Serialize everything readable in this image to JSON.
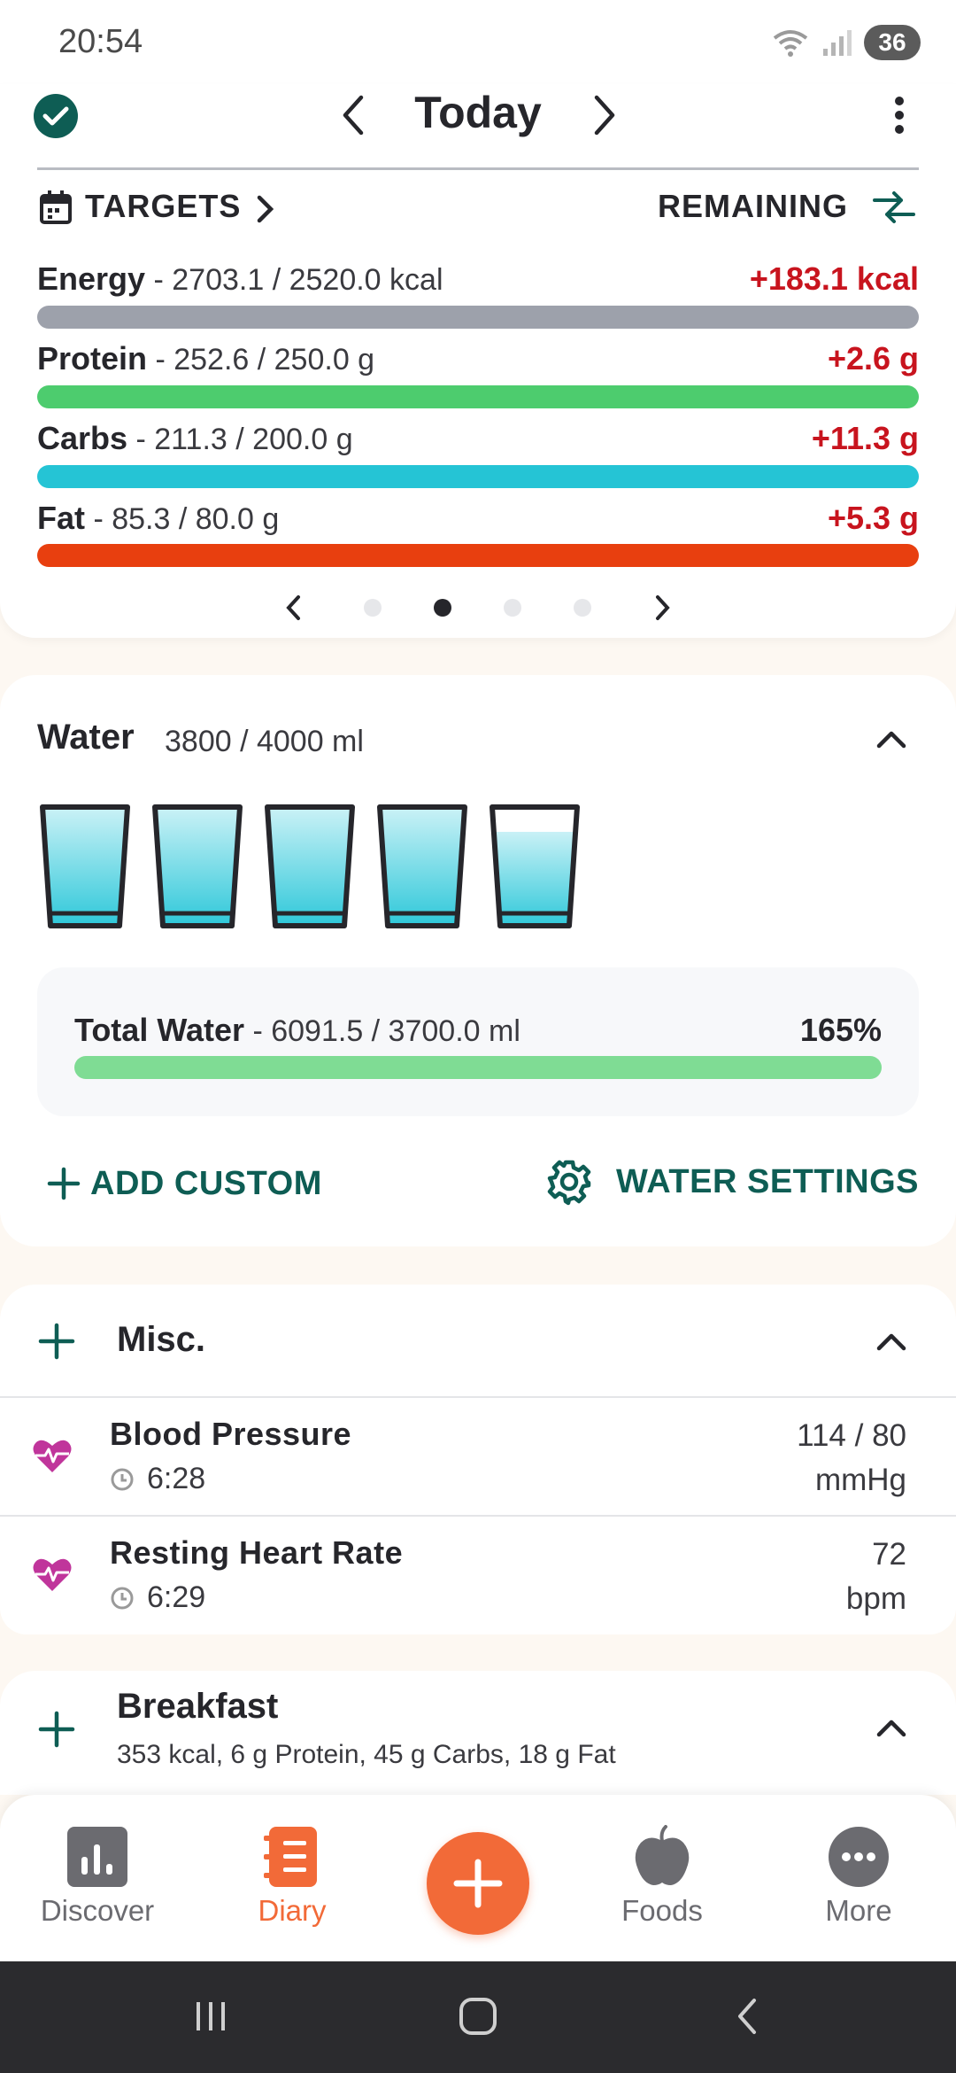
{
  "status_bar": {
    "time": "20:54",
    "battery": "36"
  },
  "header": {
    "title": "Today"
  },
  "targets": {
    "label": "TARGETS",
    "remaining_label": "REMAINING",
    "nutrients": [
      {
        "name": "Energy",
        "values": " - 2703.1 / 2520.0 kcal",
        "delta": "+183.1 kcal",
        "color": "#9da1ab",
        "fill": 1.0
      },
      {
        "name": "Protein",
        "values": " - 252.6 / 250.0 g",
        "delta": "+2.6 g",
        "color": "#4dcc6e",
        "fill": 1.0
      },
      {
        "name": "Carbs",
        "values": " - 211.3 / 200.0 g",
        "delta": "+11.3 g",
        "color": "#25c4d5",
        "fill": 1.0
      },
      {
        "name": "Fat",
        "values": " - 85.3 / 80.0 g",
        "delta": "+5.3 g",
        "color": "#e83f0f",
        "fill": 1.0
      }
    ],
    "page_count": 4,
    "active_page": 2
  },
  "water": {
    "title": "Water",
    "amount": "3800 / 4000 ml",
    "glass_fill": [
      1.0,
      1.0,
      1.0,
      1.0,
      0.8
    ],
    "total_name": "Total Water",
    "total_values": " - 6091.5 / 3700.0 ml",
    "total_percent": "165%",
    "total_fill": 1.0,
    "add_custom": "ADD CUSTOM",
    "settings": "WATER SETTINGS"
  },
  "misc": {
    "title": "Misc.",
    "items": [
      {
        "name": "Blood Pressure",
        "time": "6:28",
        "value": "114 / 80",
        "unit": "mmHg"
      },
      {
        "name": "Resting Heart Rate",
        "time": "6:29",
        "value": "72",
        "unit": "bpm"
      }
    ]
  },
  "breakfast": {
    "title": "Breakfast",
    "summary": "353 kcal, 6 g Protein, 45 g Carbs, 18 g Fat"
  },
  "bottom_nav": {
    "discover": "Discover",
    "diary": "Diary",
    "foods": "Foods",
    "more": "More"
  },
  "colors": {
    "accent": "#0e5d54",
    "brand_orange": "#f26a38",
    "over_red": "#c8141e",
    "heart": "#c0359b"
  }
}
